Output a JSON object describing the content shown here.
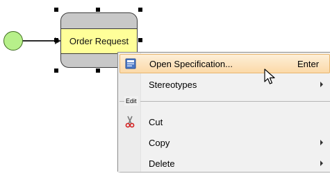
{
  "diagram": {
    "initial_node_color": "#b7f08a",
    "action": {
      "label": "Order Request",
      "fill_color": "#ffff99",
      "border_color": "#c8c8c8"
    }
  },
  "context_menu": {
    "items": [
      {
        "label": "Open Specification...",
        "shortcut": "Enter",
        "icon": "specification-icon",
        "highlighted": true
      },
      {
        "label": "Stereotypes",
        "submenu": true
      }
    ],
    "section_label": "Edit",
    "edit_items": [
      {
        "label": "Cut",
        "icon": "scissors-icon"
      },
      {
        "label": "Copy",
        "submenu": true
      },
      {
        "label": "Delete",
        "submenu": true
      }
    ],
    "highlight_color": "#fbd9a8"
  }
}
